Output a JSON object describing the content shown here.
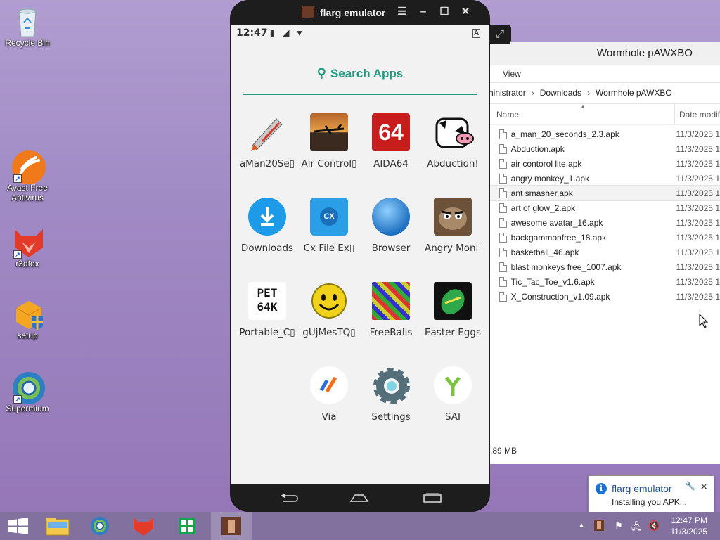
{
  "desktop_icons": [
    {
      "label": "Recycle Bin",
      "icon": "recycle-bin-icon"
    },
    {
      "label": "Avast Free Antivirus",
      "icon": "avast-icon"
    },
    {
      "label": "r3dfox",
      "icon": "r3dfox-icon"
    },
    {
      "label": "setup",
      "icon": "setup-icon"
    },
    {
      "label": "Supermium",
      "icon": "supermium-icon"
    }
  ],
  "emulator": {
    "title": "flarg emulator",
    "status": {
      "time": "12:47"
    },
    "search_label": "Search Apps",
    "apps": [
      {
        "label": "aMan20Se▯",
        "icon": "rocket-icon"
      },
      {
        "label": "Air Control▯",
        "icon": "plane-icon"
      },
      {
        "label": "AIDA64",
        "icon": "aida64-icon",
        "icon_text": "64"
      },
      {
        "label": "Abduction!",
        "icon": "cow-icon"
      },
      {
        "label": "Downloads",
        "icon": "download-icon"
      },
      {
        "label": "Cx File Ex▯",
        "icon": "cx-folder-icon",
        "icon_text": "CX"
      },
      {
        "label": "Browser",
        "icon": "globe-icon"
      },
      {
        "label": "Angry Mon▯",
        "icon": "monkey-icon"
      },
      {
        "label": "Portable_C▯",
        "icon": "pet64k-icon",
        "icon_text": "PET 64K"
      },
      {
        "label": "gUjMesTQ▯",
        "icon": "smiley-icon"
      },
      {
        "label": "FreeBalls",
        "icon": "balls-icon"
      },
      {
        "label": "Easter Eggs",
        "icon": "easter-egg-icon"
      },
      {
        "label": "Via",
        "icon": "via-icon"
      },
      {
        "label": "Settings",
        "icon": "settings-icon"
      },
      {
        "label": "SAI",
        "icon": "sai-icon"
      }
    ]
  },
  "explorer": {
    "title": "Wormhole pAWXBO",
    "ribbon_tab": "View",
    "breadcrumb": [
      "ninistrator",
      "Downloads",
      "Wormhole pAWXBO"
    ],
    "columns": {
      "name": "Name",
      "date": "Date modif"
    },
    "files": [
      {
        "name": "a_man_20_seconds_2.3.apk",
        "date": "11/3/2025 1"
      },
      {
        "name": "Abduction.apk",
        "date": "11/3/2025 1"
      },
      {
        "name": "air contorol lite.apk",
        "date": "11/3/2025 1"
      },
      {
        "name": "angry monkey_1.apk",
        "date": "11/3/2025 1"
      },
      {
        "name": "ant smasher.apk",
        "date": "11/3/2025 1"
      },
      {
        "name": "art of glow_2.apk",
        "date": "11/3/2025 1"
      },
      {
        "name": "awesome avatar_16.apk",
        "date": "11/3/2025 1"
      },
      {
        "name": "backgammonfree_18.apk",
        "date": "11/3/2025 1"
      },
      {
        "name": "basketball_46.apk",
        "date": "11/3/2025 1"
      },
      {
        "name": "blast monkeys free_1007.apk",
        "date": "11/3/2025 1"
      },
      {
        "name": "Tic_Tac_Toe_v1.6.apk",
        "date": "11/3/2025 1"
      },
      {
        "name": "X_Construction_v1.09.apk",
        "date": "11/3/2025 1"
      }
    ],
    "status_size": ".89 MB"
  },
  "notification": {
    "title": "flarg emulator",
    "body": "Installing you APK..."
  },
  "clock": {
    "time": "12:47 PM",
    "date": "11/3/2025"
  }
}
